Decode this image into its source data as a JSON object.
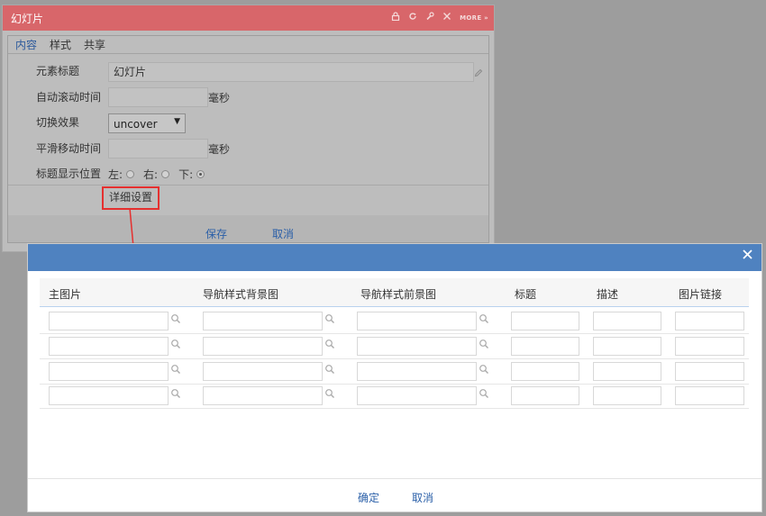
{
  "panel": {
    "title": "幻灯片",
    "more": "MORE »",
    "tabs": [
      "内容",
      "样式",
      "共享"
    ],
    "fields": {
      "element_title_label": "元素标题",
      "element_title_value": "幻灯片",
      "auto_scroll_label": "自动滚动时间",
      "auto_scroll_unit": "毫秒",
      "switch_effect_label": "切换效果",
      "switch_effect_value": "uncover",
      "smooth_move_label": "平滑移动时间",
      "smooth_move_unit": "毫秒",
      "title_position_label": "标题显示位置",
      "pos_left": "左:",
      "pos_right": "右:",
      "pos_bottom": "下:",
      "selected_position": "下"
    },
    "detail_button": "详细设置",
    "save_button": "保存",
    "cancel_button": "取消"
  },
  "dialog": {
    "columns": [
      "主图片",
      "导航样式背景图",
      "导航样式前景图",
      "标题",
      "描述",
      "图片链接"
    ],
    "rows": [
      [
        "",
        "",
        "",
        "",
        "",
        ""
      ],
      [
        "",
        "",
        "",
        "",
        "",
        ""
      ],
      [
        "",
        "",
        "",
        "",
        "",
        ""
      ],
      [
        "",
        "",
        "",
        "",
        "",
        ""
      ]
    ],
    "ok_button": "确定",
    "cancel_button": "取消"
  },
  "colors": {
    "panel_header": "#d8666a",
    "dialog_header": "#4f82c0",
    "highlight_border": "#e5302f",
    "link": "#2a5fa8"
  }
}
